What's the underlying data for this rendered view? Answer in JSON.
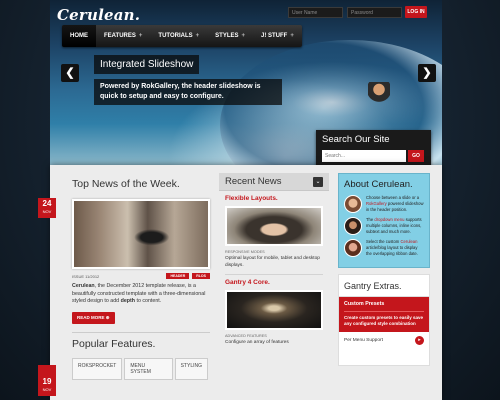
{
  "header": {
    "logo": "Cerulean.",
    "login_user_placeholder": "User Name",
    "login_pass_placeholder": "Password",
    "login_button": "LOG IN"
  },
  "nav": {
    "items": [
      {
        "label": "HOME",
        "has_plus": false
      },
      {
        "label": "FEATURES",
        "has_plus": true
      },
      {
        "label": "TUTORIALS",
        "has_plus": true
      },
      {
        "label": "STYLES",
        "has_plus": true
      },
      {
        "label": "J! STUFF",
        "has_plus": true
      }
    ],
    "plus_glyph": "+"
  },
  "slideshow": {
    "title": "Integrated Slideshow",
    "description": "Powered by RokGallery, the header slideshow is quick to setup and easy to configure.",
    "prev_glyph": "❮",
    "next_glyph": "❯"
  },
  "search": {
    "title": "Search Our Site",
    "placeholder": "Search...",
    "go_label": "GO"
  },
  "top_news": {
    "heading": "Top News of the Week.",
    "date_day": "24",
    "date_month": "NOV",
    "issue": "ISSUE 11/2012",
    "tags": [
      "HEADER",
      "RLOS"
    ],
    "excerpt_bold": "Cerulean",
    "excerpt_rest": ", the December 2012 template release, is a beautifully constructed template with a three-dimensional styled design to add ",
    "excerpt_depth": "depth",
    "excerpt_end": " to content.",
    "read_more": "READ MORE ⊕"
  },
  "popular": {
    "heading": "Popular Features.",
    "date_day": "19",
    "date_month": "NOV",
    "tabs": [
      "ROKSPROCKET",
      "MENU SYSTEM",
      "STYLING"
    ]
  },
  "recent_news": {
    "heading": "Recent News",
    "chevron": "❯",
    "items": [
      {
        "title": "Flexible Layouts.",
        "category": "RESPONSIVE MODES",
        "text": "Optimal layout for mobile, tablet and desktop displays."
      },
      {
        "title": "Gantry 4 Core.",
        "category": "ADVANCED FEATURES",
        "text": "Configure an array of features"
      }
    ]
  },
  "about": {
    "heading": "About Cerulean.",
    "rows": [
      {
        "pre": "Choose between a slide or a ",
        "red": "RokGallery",
        "post": " powered slideshow in the header position."
      },
      {
        "pre": "The ",
        "red": "dropdown menu",
        "post": " supports multiple columns, inline icons, subtext and much more."
      },
      {
        "pre": "Select the custom ",
        "red": "Cerulean",
        "post": " article/blog layout to display the overlapping ribbon date."
      }
    ]
  },
  "gantry": {
    "heading": "Gantry Extras.",
    "panel_title": "Custom Presets",
    "panel_text": "Create custom presets to easily save any configured style combination",
    "row_label": "Per Menu Support",
    "row_glyph": "▸"
  },
  "colors": {
    "accent": "#c4161c",
    "about_bg": "#82cfe5",
    "nav_bg": "#1e1e1e"
  }
}
